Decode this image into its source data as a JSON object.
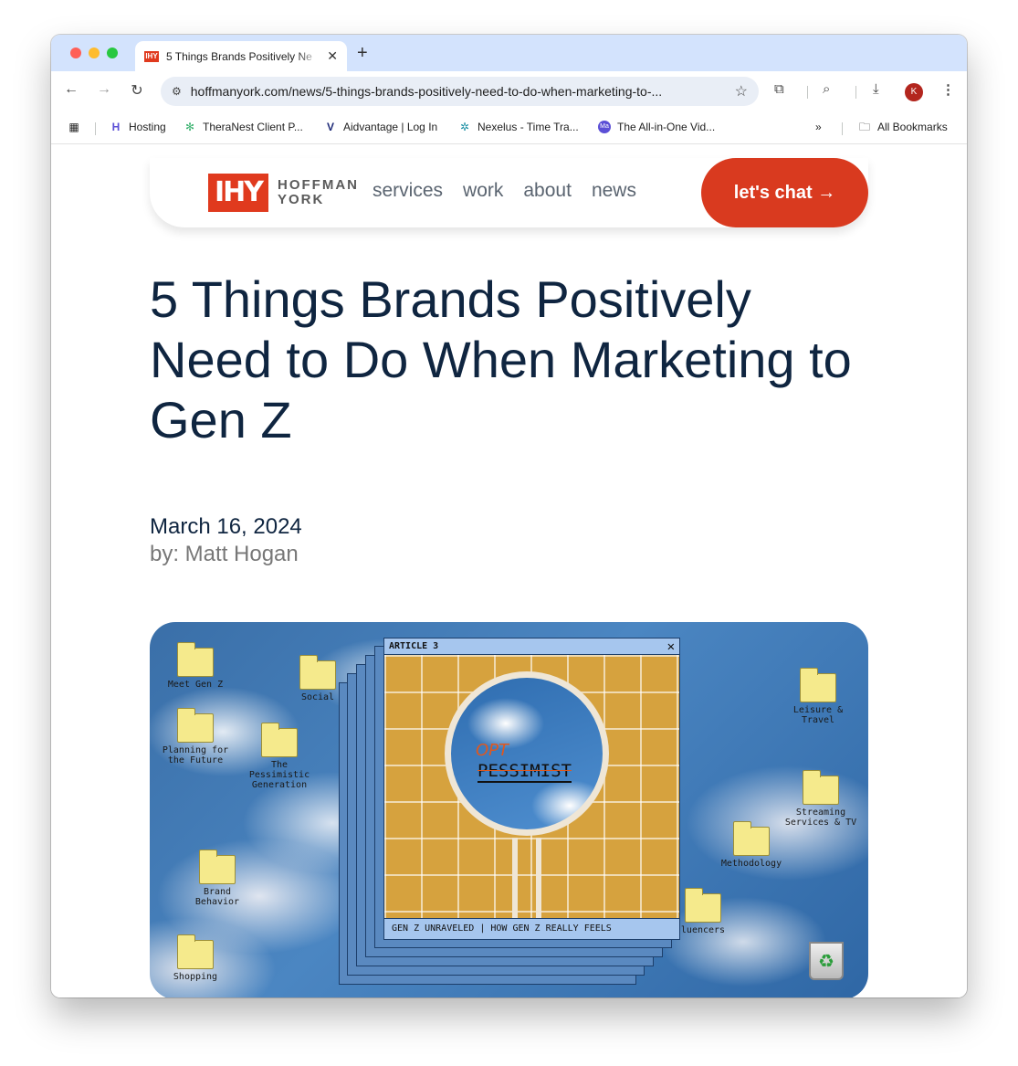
{
  "browser": {
    "tab_title": "5 Things Brands Positively Ne",
    "url": "hoffmanyork.com/news/5-things-brands-positively-need-to-do-when-marketing-to-...",
    "profile_initial": "K",
    "bookmarks": [
      "Hosting",
      "TheraNest Client P...",
      "Aidvantage | Log In",
      "Nexelus - Time Tra...",
      "The All-in-One Vid..."
    ],
    "all_bookmarks": "All Bookmarks",
    "favicon_text": "IHY",
    "icons": {
      "back": "back-arrow-icon",
      "forward": "forward-arrow-icon",
      "reload": "reload-icon",
      "site_info": "site-info-icon",
      "bookmark": "star-icon",
      "extensions": "puzzle-icon",
      "lens": "lens-icon",
      "download": "download-icon",
      "menu": "kebab-menu-icon",
      "apps": "apps-grid-icon",
      "overflow": "chevron-double-right-icon",
      "folder": "folder-icon"
    },
    "accent": "#d3e3fd"
  },
  "site": {
    "logo_mark": "IHY",
    "logo_line1": "HOFFMAN",
    "logo_line2": "YORK",
    "nav": [
      "services",
      "work",
      "about",
      "news"
    ],
    "cta": "let's chat →",
    "brand_color": "#d93a1f",
    "text_color": "#0f2540"
  },
  "article": {
    "headline": "5 Things Brands Positively Need to Do When Marketing to Gen Z",
    "date": "March 16, 2024",
    "byline": "by: Matt Hogan"
  },
  "hero": {
    "folders": {
      "meet": "Meet Gen Z",
      "social": "Social",
      "planning": "Planning for the Future",
      "pessimistic": "The Pessimistic Generation",
      "brand": "Brand Behavior",
      "shopping": "Shopping",
      "leisure": "Leisure & Travel",
      "streaming": "Streaming Services & TV",
      "methodology": "Methodology",
      "influencers": "luencers"
    },
    "window_title": "ARTICLE 3",
    "window_close": "✕",
    "opt_text": "OPT",
    "pessimist_text": "PESSIMIST",
    "footer": "GEN Z UNRAVELED | HOW GEN Z REALLY FEELS",
    "trash_icon": "recycle-bin-icon"
  }
}
